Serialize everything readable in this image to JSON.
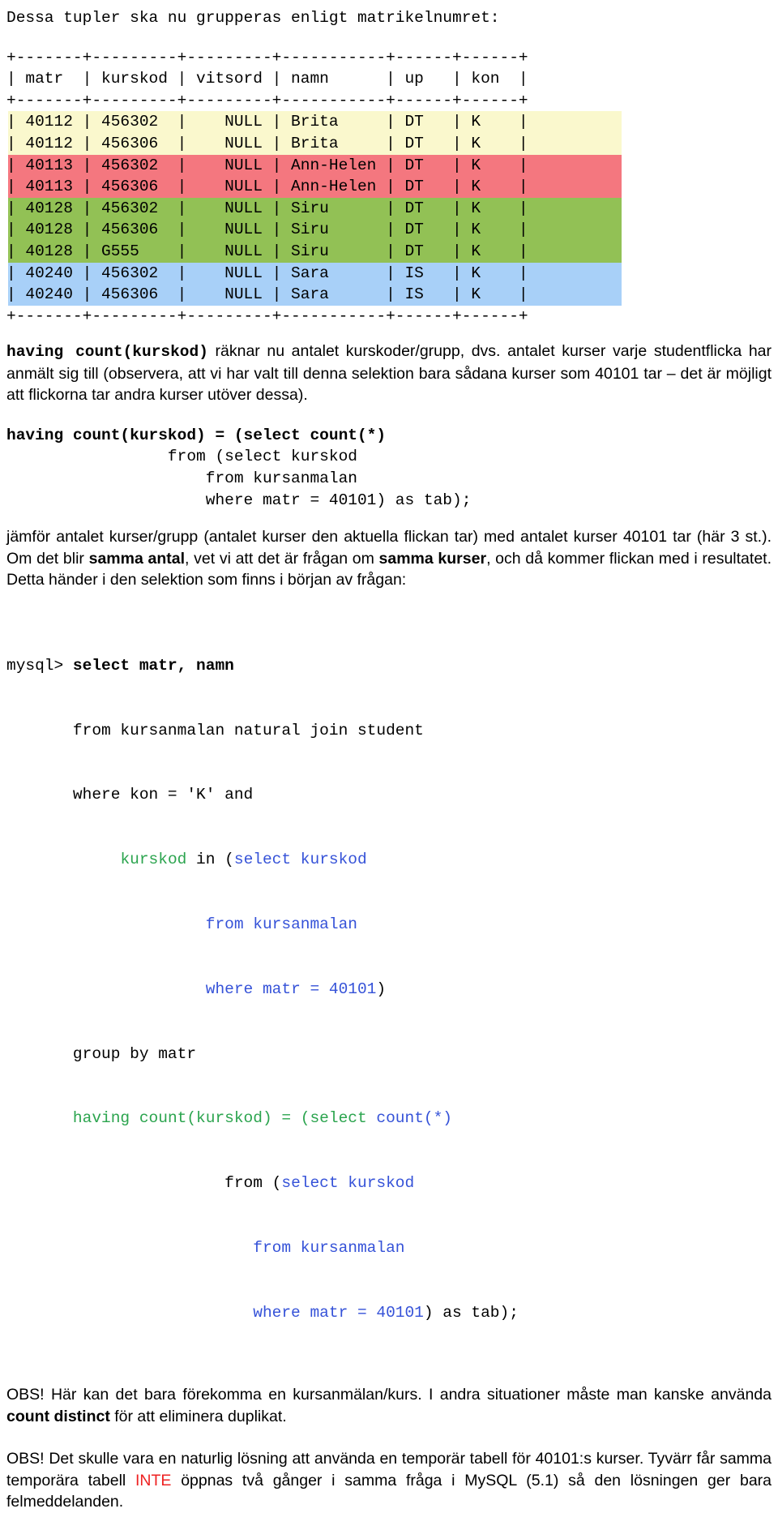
{
  "document": {
    "intro_heading": "Dessa tupler ska nu grupperas enligt matrikelnumret:",
    "result_table": {
      "border_line": "+-------+---------+---------+-----------+------+------+",
      "header_line": "| matr  | kurskod | vitsord | namn      | up   | kon  |",
      "columns": [
        "matr",
        "kurskod",
        "vitsord",
        "namn",
        "up",
        "kon"
      ],
      "rows": [
        {
          "line": "| 40112 | 456302  |    NULL | Brita     | DT   | K    |",
          "matr": "40112",
          "kurskod": "456302",
          "vitsord": "NULL",
          "namn": "Brita",
          "up": "DT",
          "kon": "K",
          "group": "yellow"
        },
        {
          "line": "| 40112 | 456306  |    NULL | Brita     | DT   | K    |",
          "matr": "40112",
          "kurskod": "456306",
          "vitsord": "NULL",
          "namn": "Brita",
          "up": "DT",
          "kon": "K",
          "group": "yellow"
        },
        {
          "line": "| 40113 | 456302  |    NULL | Ann-Helen | DT   | K    |",
          "matr": "40113",
          "kurskod": "456302",
          "vitsord": "NULL",
          "namn": "Ann-Helen",
          "up": "DT",
          "kon": "K",
          "group": "red"
        },
        {
          "line": "| 40113 | 456306  |    NULL | Ann-Helen | DT   | K    |",
          "matr": "40113",
          "kurskod": "456306",
          "vitsord": "NULL",
          "namn": "Ann-Helen",
          "up": "DT",
          "kon": "K",
          "group": "red"
        },
        {
          "line": "| 40128 | 456302  |    NULL | Siru      | DT   | K    |",
          "matr": "40128",
          "kurskod": "456302",
          "vitsord": "NULL",
          "namn": "Siru",
          "up": "DT",
          "kon": "K",
          "group": "green"
        },
        {
          "line": "| 40128 | 456306  |    NULL | Siru      | DT   | K    |",
          "matr": "40128",
          "kurskod": "456306",
          "vitsord": "NULL",
          "namn": "Siru",
          "up": "DT",
          "kon": "K",
          "group": "green"
        },
        {
          "line": "| 40128 | G555    |    NULL | Siru      | DT   | K    |",
          "matr": "40128",
          "kurskod": "G555",
          "vitsord": "NULL",
          "namn": "Siru",
          "up": "DT",
          "kon": "K",
          "group": "green"
        },
        {
          "line": "| 40240 | 456302  |    NULL | Sara      | IS   | K    |",
          "matr": "40240",
          "kurskod": "456302",
          "vitsord": "NULL",
          "namn": "Sara",
          "up": "IS",
          "kon": "K",
          "group": "blue"
        },
        {
          "line": "| 40240 | 456306  |    NULL | Sara      | IS   | K    |",
          "matr": "40240",
          "kurskod": "456306",
          "vitsord": "NULL",
          "namn": "Sara",
          "up": "IS",
          "kon": "K",
          "group": "blue"
        }
      ],
      "group_colors": {
        "yellow": "#faf8cd",
        "red": "#f4777f",
        "green": "#92c155",
        "blue": "#a8d0f8"
      }
    },
    "para_having": {
      "code": "having count(kurskod)",
      "text": " räknar nu antalet kurskoder/grupp, dvs. antalet kurser varje studentflicka har anmält sig till (observera, att vi har valt till denna selektion bara sådana kurser som 40101 tar – det är möjligt att flickorna tar andra kurser utöver dessa)."
    },
    "code_having": {
      "line1": "having count(kurskod) = (select count(*)",
      "line2": "                 from (select kurskod",
      "line3": "                     from kursanmalan",
      "line4": "                     where matr = 40101) as tab);"
    },
    "para_jamfor": {
      "t1": "jämför antalet kurser/grupp (antalet kurser den aktuella flickan tar) med antalet kurser 40101 tar (här 3 st.). Om det blir ",
      "b1": "samma antal",
      "t2": ", vet vi att det är frågan om ",
      "b2": "samma kurser",
      "t3": ", och då kommer flickan med i resultatet. Detta händer i den selektion som finns i början av frågan:"
    },
    "sql_query": {
      "prompt": "mysql> ",
      "l1_bold": "select matr, namn",
      "l2": "       from kursanmalan natural join student",
      "l3": "       where kon = 'K' and",
      "l4_pad": "            ",
      "l4_green": "kurskod",
      "l4_mid": " in (",
      "l4_blue": "select kurskod",
      "l5_pad": "                     ",
      "l5_blue": "from kursanmalan",
      "l6_pad": "                     ",
      "l6_blue": "where matr = 40101",
      "l6_black": ")",
      "l7": "       group by matr",
      "l8_pad": "       ",
      "l8_green": "having count(kurskod) = (select ",
      "l8_blue": "count(*)",
      "l9_pad": "                       ",
      "l9_black": "from (",
      "l9_blue": "select kurskod",
      "l10_pad": "                          ",
      "l10_blue": "from kursanmalan",
      "l11_pad": "                          ",
      "l11_blue": "where matr = 40101",
      "l11_black": ") as tab);"
    },
    "obs1": {
      "t1": "OBS! Här kan det bara förekomma en kursanmälan/kurs. I andra situationer måste man kanske använda ",
      "b1": "count distinct",
      "t2": " för att eliminera duplikat."
    },
    "obs2": {
      "t1": "OBS! Det skulle vara en naturlig lösning att använda en temporär tabell för 40101:s kurser. Tyvärr får samma temporära tabell ",
      "r1": "INTE",
      "t2": " öppnas två gånger i samma fråga i MySQL (5.1) så den lösningen ger bara felmeddelanden."
    },
    "accents": {
      "green": "#2ba44e",
      "blue": "#3552d8",
      "red": "#ee2222"
    }
  }
}
